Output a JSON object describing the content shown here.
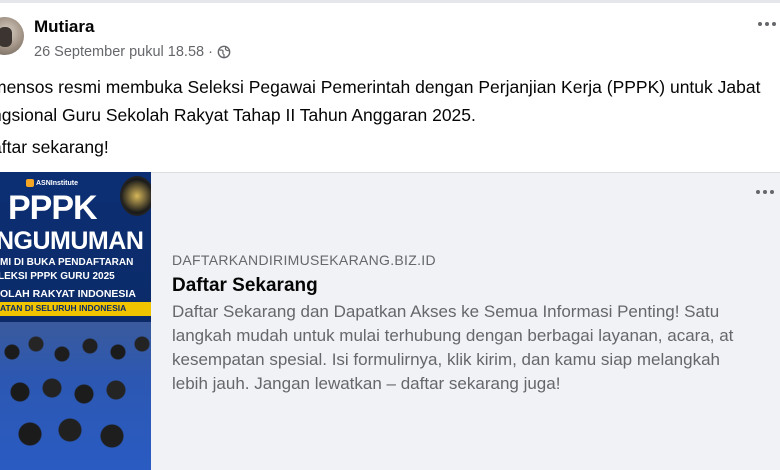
{
  "post": {
    "author": "Mutiara",
    "timestamp": "26 September pukul 18.58",
    "separator": "·",
    "privacy_icon": "globe-icon",
    "text_line1": "mensos resmi membuka Seleksi Pegawai Pemerintah dengan Perjanjian Kerja (PPPK) untuk Jabat",
    "text_line2": "ngsional Guru Sekolah Rakyat Tahap II Tahun Anggaran 2025.",
    "cta": "aftar sekarang!"
  },
  "thumbnail": {
    "brand": "ASNInstitute",
    "headline": "PPPK",
    "announce": "NGUMUMAN",
    "line1": "MI DI BUKA PENDAFTARAN",
    "line2": "LEKSI PPPK GURU 2025",
    "line3": "OLAH RAKYAT INDONESIA",
    "line4": "ATAN DI SELURUH INDONESIA"
  },
  "link": {
    "domain": "DAFTARKANDIRIMUSEKARANG.BIZ.ID",
    "title": "Daftar Sekarang",
    "desc_line1": "Daftar Sekarang dan Dapatkan Akses ke Semua Informasi Penting! Satu",
    "desc_line2": "langkah mudah untuk mulai terhubung dengan berbagai layanan, acara, at",
    "desc_line3": "kesempatan spesial. Isi formulirnya, klik kirim, dan kamu siap melangkah",
    "desc_line4": "lebih jauh. Jangan lewatkan – daftar sekarang juga!"
  },
  "colors": {
    "text_primary": "#050505",
    "text_secondary": "#65676b",
    "card_bg": "#f0f2f5",
    "thumb_blue": "#0b2a66",
    "thumb_yellow": "#f1c400"
  }
}
